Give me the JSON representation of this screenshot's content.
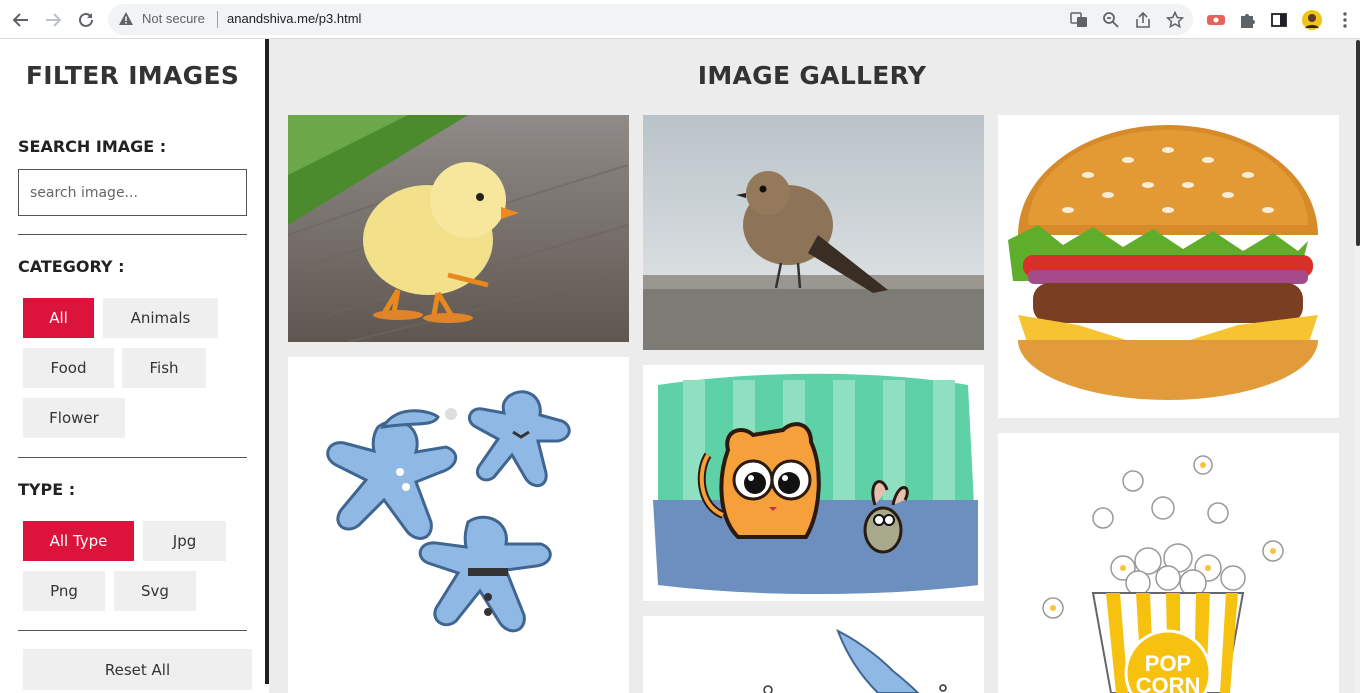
{
  "browser": {
    "security_label": "Not secure",
    "url": "anandshiva.me/p3.html"
  },
  "sidebar": {
    "title": "FILTER IMAGES",
    "search_label": "SEARCH IMAGE :",
    "search_placeholder": "search image...",
    "category_label": "CATEGORY :",
    "categories": [
      "All",
      "Animals",
      "Food",
      "Fish",
      "Flower"
    ],
    "type_label": "TYPE :",
    "types": [
      "All Type",
      "Jpg",
      "Png",
      "Svg"
    ],
    "reset_label": "Reset All"
  },
  "gallery": {
    "title": "IMAGE GALLERY",
    "images": [
      {
        "name": "chick",
        "type": "photo"
      },
      {
        "name": "bird",
        "type": "photo"
      },
      {
        "name": "burger",
        "type": "illustration"
      },
      {
        "name": "gingerbread-men",
        "type": "illustration"
      },
      {
        "name": "cat-and-mouse",
        "type": "illustration"
      },
      {
        "name": "popcorn",
        "type": "illustration",
        "text": "POP CORN"
      },
      {
        "name": "fish-sketch",
        "type": "illustration"
      }
    ]
  },
  "colors": {
    "accent": "#dc143c",
    "pill_bg": "#efefef",
    "gallery_bg": "#ececec"
  }
}
